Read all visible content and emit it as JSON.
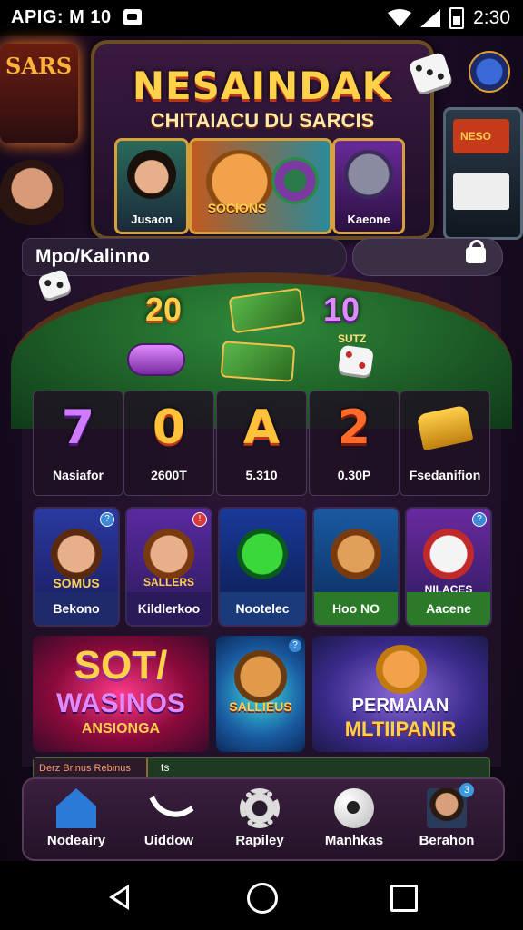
{
  "status_bar": {
    "left_text": "APIG: M 10",
    "time": "2:30"
  },
  "banner": {
    "title": "NESAINDAK",
    "subtitle": "CHITAIACU DU SARCIS",
    "cards": [
      {
        "label": "Jusaon"
      },
      {
        "label": "SOCIONS"
      },
      {
        "label": "Kaeone"
      }
    ]
  },
  "background": {
    "sign": "SARS",
    "slot_screen": "NESO"
  },
  "header": {
    "title": "Mpo/Kalinno"
  },
  "table": {
    "amounts": [
      "20",
      "10"
    ],
    "note": "SUTZ"
  },
  "stats": [
    {
      "big": "7",
      "caption": "Nasiafor"
    },
    {
      "big": "0",
      "caption": "2600T"
    },
    {
      "big": "A",
      "caption": "5.310"
    },
    {
      "big": "2",
      "caption": "0.30P"
    },
    {
      "big": "",
      "caption": "Fsedanifion"
    }
  ],
  "games": [
    {
      "label": "Bekono",
      "art": "SOMUS"
    },
    {
      "label": "Kildlerkoo",
      "art": "SALLERS"
    },
    {
      "label": "Nootelec",
      "art": ""
    },
    {
      "label": "Hoo NO",
      "art": ""
    },
    {
      "label": "Aacene",
      "art": "NILACES"
    }
  ],
  "promos": [
    {
      "line1": "SOT/",
      "line2": "WASINOS",
      "line3": "ANSIONGA"
    },
    {
      "line1": "SALLIEUS"
    },
    {
      "line1": "PERMAIAN",
      "line2": "MLTIIPANIR"
    }
  ],
  "strip": {
    "left": "Derz Brinus Rebinus",
    "right": "ts"
  },
  "bottom_nav": [
    {
      "label": "Nodeairy",
      "icon": "home-icon"
    },
    {
      "label": "Uiddow",
      "icon": "phone-icon"
    },
    {
      "label": "Rapiley",
      "icon": "gear-icon"
    },
    {
      "label": "Manhkas",
      "icon": "soccer-ball-icon"
    },
    {
      "label": "Berahon",
      "icon": "avatar-icon",
      "badge": "3"
    }
  ],
  "colors": {
    "accent_gold": "#ffc23a",
    "panel_bg": "#2b1f36",
    "nav_blue": "#2a7ad8"
  }
}
